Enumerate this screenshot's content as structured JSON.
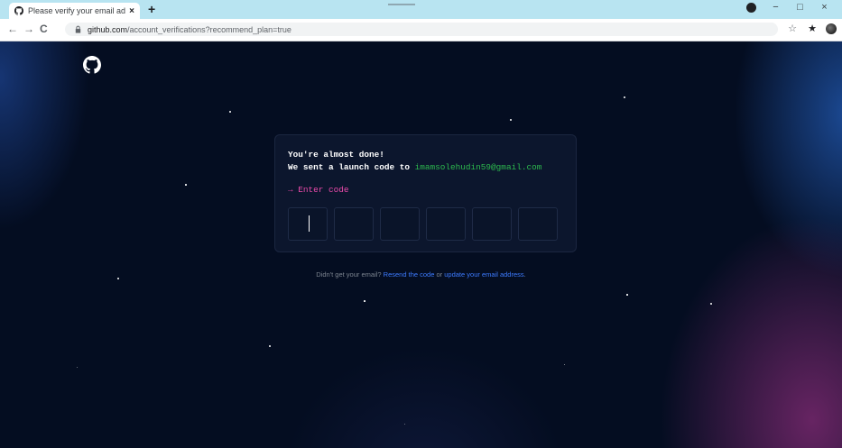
{
  "browser": {
    "tab_title": "Please verify your email address",
    "tab_close": "×",
    "new_tab": "+",
    "url_domain": "github.com",
    "url_path": "/account_verifications?recommend_plan=true",
    "nav": {
      "back": "←",
      "forward": "→",
      "reload": "C"
    },
    "window": {
      "minimize": "−",
      "maximize": "□",
      "close": "×"
    },
    "toolbar_icons": {
      "bookmark": "☆",
      "extensions": "★"
    }
  },
  "verify": {
    "line1": "You're almost done!",
    "line2_prefix": "We sent a launch code to",
    "email": "imamsolehudin59@gmail.com",
    "prompt": "→ Enter code",
    "code_digits": [
      "",
      "",
      "",
      "",
      "",
      ""
    ]
  },
  "footer": {
    "prefix": "Didn't get your email?",
    "resend_link": "Resend the code",
    "or": "or",
    "update_link": "update your email address",
    "end": "."
  },
  "colors": {
    "background": "#040d21",
    "card": "#0c162d",
    "email_green": "#2dba4e",
    "prompt_pink": "#ea4aaa",
    "link_blue": "#3d7bff"
  }
}
